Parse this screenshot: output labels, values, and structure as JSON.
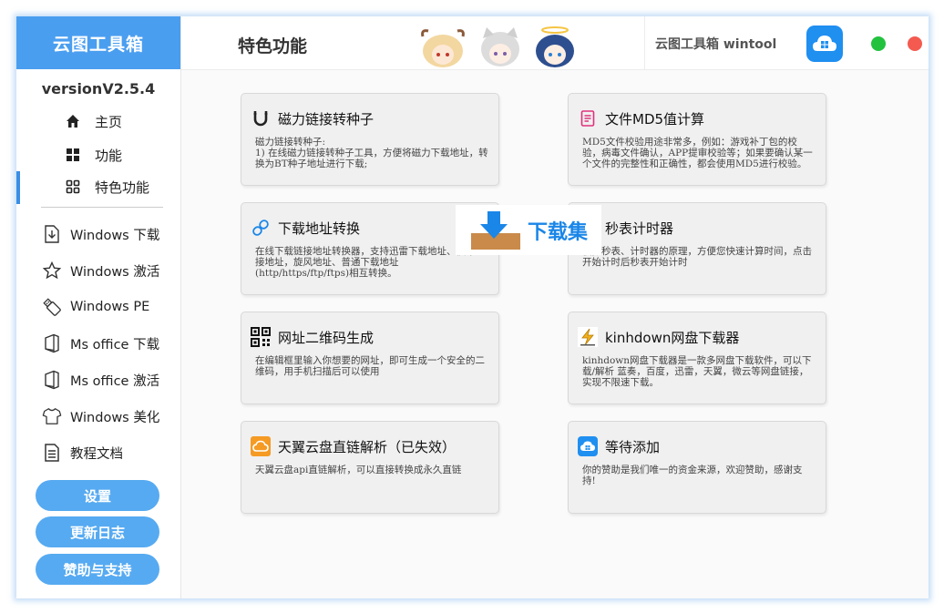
{
  "sidebar": {
    "brand": "云图工具箱",
    "version": "versionV2.5.4",
    "nav": [
      {
        "label": "主页",
        "icon": "home-icon"
      },
      {
        "label": "功能",
        "icon": "grid-icon"
      },
      {
        "label": "特色功能",
        "icon": "apps-icon"
      }
    ],
    "tools": [
      {
        "label": "Windows 下载",
        "icon": "download-file-icon"
      },
      {
        "label": "Windows 激活",
        "icon": "star-icon"
      },
      {
        "label": "Windows PE",
        "icon": "usb-icon"
      },
      {
        "label": "Ms office 下载",
        "icon": "office-icon"
      },
      {
        "label": "Ms office 激活",
        "icon": "office-icon"
      },
      {
        "label": "Windows 美化",
        "icon": "tshirt-icon"
      },
      {
        "label": "教程文档",
        "icon": "document-icon"
      }
    ],
    "buttons": [
      "设置",
      "更新日志",
      "赞助与支持"
    ]
  },
  "header": {
    "title": "特色功能",
    "app_name": "云图工具箱 wintool"
  },
  "cards": [
    {
      "title": "磁力链接转种子",
      "icon": "magnet-icon",
      "desc": "磁力链接转种子:\n1) 在线磁力链接转种子工具，方便将磁力下载地址，转换为BT种子地址进行下载;"
    },
    {
      "title": "文件MD5值计算",
      "icon": "file-md5-icon",
      "desc": "MD5文件校验用途非常多，例如：游戏补丁包的校验，病毒文件确认，APP提审校验等；如果要确认某一个文件的完整性和正确性，都会使用MD5进行校验。"
    },
    {
      "title": "下载地址转换",
      "icon": "link-icon",
      "desc": "在线下载链接地址转换器，支持迅雷下载地址、快车链接地址，旋风地址、普通下载地址(http/https/ftp/ftps)相互转换。"
    },
    {
      "title": "秒表计时器",
      "icon": "stopwatch-icon",
      "desc": "模拟秒表、计时器的原理，方便您快速计算时间，点击开始计时后秒表开始计时"
    },
    {
      "title": "网址二维码生成",
      "icon": "qrcode-icon",
      "desc": "在编辑框里输入你想要的网址，即可生成一个安全的二维码，用手机扫描后可以使用"
    },
    {
      "title": "kinhdown网盘下载器",
      "icon": "lightning-icon",
      "desc": "kinhdown网盘下载器是一款多网盘下载软件，可以下载/解析 蓝奏，百度，迅雷，天翼，微云等网盘链接，实现不限速下载。"
    },
    {
      "title": "天翼云盘直链解析（已失效）",
      "icon": "cloud-icon",
      "desc": "天翼云盘api直链解析，可以直接转换成永久直链"
    },
    {
      "title": "等待添加",
      "icon": "cloud-box-icon",
      "desc": "你的赞助是我们唯一的资金来源，欢迎赞助，感谢支持!"
    }
  ],
  "watermark": "下载集",
  "colors": {
    "accent": "#4a9ef0",
    "button": "#56aaf1",
    "active_bar": "#3a8ee6",
    "close": "#f45a4f",
    "minimize": "#22c23f"
  }
}
